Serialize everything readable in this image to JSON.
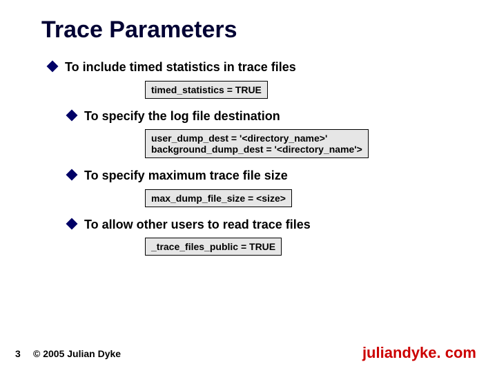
{
  "title": "Trace Parameters",
  "bullets": {
    "b1": "To include timed statistics in trace files",
    "b2": "To specify the log file destination",
    "b3": "To specify maximum trace file size",
    "b4": "To allow other users to read trace files"
  },
  "code": {
    "c1": "timed_statistics = TRUE",
    "c2": "user_dump_dest = '<directory_name>'\nbackground_dump_dest = '<directory_name'>",
    "c3": "max_dump_file_size = <size>",
    "c4": "_trace_files_public = TRUE"
  },
  "footer": {
    "page": "3",
    "copyright": "© 2005 Julian Dyke",
    "site": "juliandyke. com"
  }
}
